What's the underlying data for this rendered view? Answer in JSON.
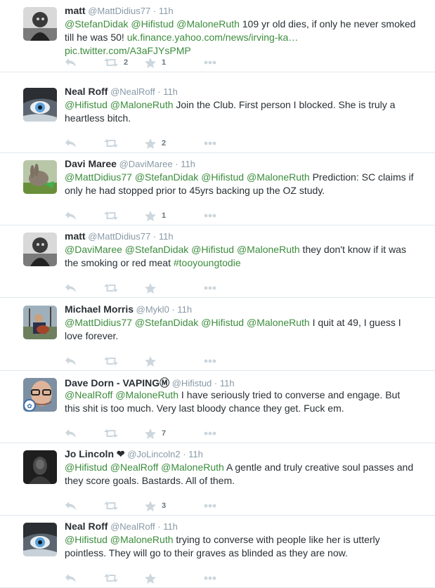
{
  "tweets": [
    {
      "name": "matt",
      "screen_name": "@MattDidius77",
      "time": "11h",
      "text": [
        {
          "t": "@StefanDidak",
          "c": "at"
        },
        {
          "t": " "
        },
        {
          "t": "@Hifistud",
          "c": "at"
        },
        {
          "t": " "
        },
        {
          "t": "@MaloneRuth",
          "c": "at"
        },
        {
          "t": " 109 yr old dies, if only he never smoked till he was 50! "
        },
        {
          "t": "uk.finance.yahoo.com/news/irving-ka…",
          "c": "link"
        },
        {
          "t": " "
        },
        {
          "t": "pic.twitter.com/A3aFJYsPMP",
          "c": "link"
        }
      ],
      "retweets": "2",
      "favorites": "1",
      "avatar": "bw-person"
    },
    {
      "name": "Neal Roff",
      "screen_name": "@NealRoff",
      "time": "11h",
      "text": [
        {
          "t": "@Hifistud",
          "c": "at"
        },
        {
          "t": " "
        },
        {
          "t": "@MaloneRuth",
          "c": "at"
        },
        {
          "t": " Join the Club. First person I blocked. She is truly a heartless bitch."
        }
      ],
      "retweets": "",
      "favorites": "2",
      "avatar": "husky-eye"
    },
    {
      "name": "Davi Maree",
      "screen_name": "@DaviMaree",
      "time": "11h",
      "text": [
        {
          "t": "@MattDidius77",
          "c": "at"
        },
        {
          "t": " "
        },
        {
          "t": "@StefanDidak",
          "c": "at"
        },
        {
          "t": " "
        },
        {
          "t": "@Hifistud",
          "c": "at"
        },
        {
          "t": " "
        },
        {
          "t": "@MaloneRuth",
          "c": "at"
        },
        {
          "t": " Prediction: SC claims if only he had stopped prior to 45yrs backing up the OZ study."
        }
      ],
      "retweets": "",
      "favorites": "1",
      "avatar": "rabbit"
    },
    {
      "name": "matt",
      "screen_name": "@MattDidius77",
      "time": "11h",
      "text": [
        {
          "t": "@DaviMaree",
          "c": "at"
        },
        {
          "t": " "
        },
        {
          "t": "@StefanDidak",
          "c": "at"
        },
        {
          "t": " "
        },
        {
          "t": "@Hifistud",
          "c": "at"
        },
        {
          "t": " "
        },
        {
          "t": "@MaloneRuth",
          "c": "at"
        },
        {
          "t": " they don't know if it was the smoking or red meat "
        },
        {
          "t": "#tooyoungtodie",
          "c": "at"
        }
      ],
      "retweets": "",
      "favorites": "",
      "avatar": "bw-person"
    },
    {
      "name": "Michael Morris",
      "screen_name": "@Mykl0",
      "time": "11h",
      "text": [
        {
          "t": "@MattDidius77",
          "c": "at"
        },
        {
          "t": " "
        },
        {
          "t": "@StefanDidak",
          "c": "at"
        },
        {
          "t": " "
        },
        {
          "t": "@Hifistud",
          "c": "at"
        },
        {
          "t": " "
        },
        {
          "t": "@MaloneRuth",
          "c": "at"
        },
        {
          "t": " I quit at 49, I guess I love forever."
        }
      ],
      "retweets": "",
      "favorites": "",
      "avatar": "guitar"
    },
    {
      "name": "Dave Dorn - VAPINGⓂ",
      "screen_name": "@Hifistud",
      "time": "11h",
      "text": [
        {
          "t": "@NealRoff",
          "c": "at"
        },
        {
          "t": " "
        },
        {
          "t": "@MaloneRuth",
          "c": "at"
        },
        {
          "t": " I have seriously tried to converse and engage. But this shit is too much. Very last bloody chance they get. Fuck em."
        }
      ],
      "retweets": "",
      "favorites": "7",
      "avatar": "glasses"
    },
    {
      "name": "Jo Lincoln ❤",
      "screen_name": "@JoLincoln2",
      "time": "11h",
      "text": [
        {
          "t": "@Hifistud",
          "c": "at"
        },
        {
          "t": " "
        },
        {
          "t": "@NealRoff",
          "c": "at"
        },
        {
          "t": " "
        },
        {
          "t": "@MaloneRuth",
          "c": "at"
        },
        {
          "t": " A gentle and truly creative soul passes and they score goals. Bastards. All of them."
        }
      ],
      "retweets": "",
      "favorites": "3",
      "avatar": "dark"
    },
    {
      "name": "Neal Roff",
      "screen_name": "@NealRoff",
      "time": "11h",
      "text": [
        {
          "t": "@Hifistud",
          "c": "at"
        },
        {
          "t": " "
        },
        {
          "t": "@MaloneRuth",
          "c": "at"
        },
        {
          "t": " trying to converse with people like her is utterly pointless. They will go to their graves as blinded as they are now."
        }
      ],
      "retweets": "",
      "favorites": "",
      "avatar": "husky-eye"
    }
  ],
  "colors": {
    "mention": "#3b8c3c",
    "text": "#292f33",
    "meta": "#8899a6",
    "icon": "#ccd6dd"
  },
  "icons": {
    "reply": "reply-icon",
    "retweet": "retweet-icon",
    "favorite": "star-icon",
    "more": "more-icon"
  }
}
